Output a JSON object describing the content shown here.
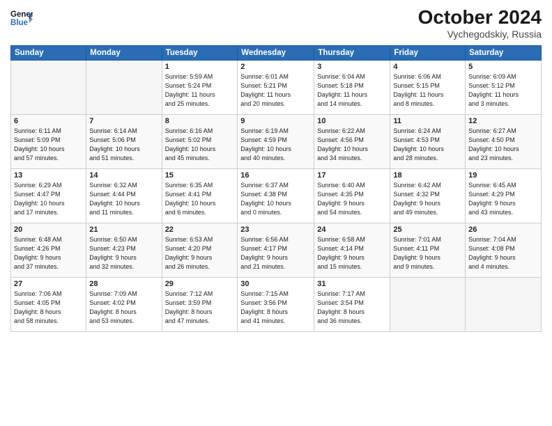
{
  "header": {
    "logo_line1": "General",
    "logo_line2": "Blue",
    "month": "October 2024",
    "location": "Vychegodskiy, Russia"
  },
  "weekdays": [
    "Sunday",
    "Monday",
    "Tuesday",
    "Wednesday",
    "Thursday",
    "Friday",
    "Saturday"
  ],
  "weeks": [
    [
      {
        "day": "",
        "info": ""
      },
      {
        "day": "",
        "info": ""
      },
      {
        "day": "1",
        "info": "Sunrise: 5:59 AM\nSunset: 5:24 PM\nDaylight: 11 hours\nand 25 minutes."
      },
      {
        "day": "2",
        "info": "Sunrise: 6:01 AM\nSunset: 5:21 PM\nDaylight: 11 hours\nand 20 minutes."
      },
      {
        "day": "3",
        "info": "Sunrise: 6:04 AM\nSunset: 5:18 PM\nDaylight: 11 hours\nand 14 minutes."
      },
      {
        "day": "4",
        "info": "Sunrise: 6:06 AM\nSunset: 5:15 PM\nDaylight: 11 hours\nand 8 minutes."
      },
      {
        "day": "5",
        "info": "Sunrise: 6:09 AM\nSunset: 5:12 PM\nDaylight: 11 hours\nand 3 minutes."
      }
    ],
    [
      {
        "day": "6",
        "info": "Sunrise: 6:11 AM\nSunset: 5:09 PM\nDaylight: 10 hours\nand 57 minutes."
      },
      {
        "day": "7",
        "info": "Sunrise: 6:14 AM\nSunset: 5:06 PM\nDaylight: 10 hours\nand 51 minutes."
      },
      {
        "day": "8",
        "info": "Sunrise: 6:16 AM\nSunset: 5:02 PM\nDaylight: 10 hours\nand 45 minutes."
      },
      {
        "day": "9",
        "info": "Sunrise: 6:19 AM\nSunset: 4:59 PM\nDaylight: 10 hours\nand 40 minutes."
      },
      {
        "day": "10",
        "info": "Sunrise: 6:22 AM\nSunset: 4:56 PM\nDaylight: 10 hours\nand 34 minutes."
      },
      {
        "day": "11",
        "info": "Sunrise: 6:24 AM\nSunset: 4:53 PM\nDaylight: 10 hours\nand 28 minutes."
      },
      {
        "day": "12",
        "info": "Sunrise: 6:27 AM\nSunset: 4:50 PM\nDaylight: 10 hours\nand 23 minutes."
      }
    ],
    [
      {
        "day": "13",
        "info": "Sunrise: 6:29 AM\nSunset: 4:47 PM\nDaylight: 10 hours\nand 17 minutes."
      },
      {
        "day": "14",
        "info": "Sunrise: 6:32 AM\nSunset: 4:44 PM\nDaylight: 10 hours\nand 11 minutes."
      },
      {
        "day": "15",
        "info": "Sunrise: 6:35 AM\nSunset: 4:41 PM\nDaylight: 10 hours\nand 6 minutes."
      },
      {
        "day": "16",
        "info": "Sunrise: 6:37 AM\nSunset: 4:38 PM\nDaylight: 10 hours\nand 0 minutes."
      },
      {
        "day": "17",
        "info": "Sunrise: 6:40 AM\nSunset: 4:35 PM\nDaylight: 9 hours\nand 54 minutes."
      },
      {
        "day": "18",
        "info": "Sunrise: 6:42 AM\nSunset: 4:32 PM\nDaylight: 9 hours\nand 49 minutes."
      },
      {
        "day": "19",
        "info": "Sunrise: 6:45 AM\nSunset: 4:29 PM\nDaylight: 9 hours\nand 43 minutes."
      }
    ],
    [
      {
        "day": "20",
        "info": "Sunrise: 6:48 AM\nSunset: 4:26 PM\nDaylight: 9 hours\nand 37 minutes."
      },
      {
        "day": "21",
        "info": "Sunrise: 6:50 AM\nSunset: 4:23 PM\nDaylight: 9 hours\nand 32 minutes."
      },
      {
        "day": "22",
        "info": "Sunrise: 6:53 AM\nSunset: 4:20 PM\nDaylight: 9 hours\nand 26 minutes."
      },
      {
        "day": "23",
        "info": "Sunrise: 6:56 AM\nSunset: 4:17 PM\nDaylight: 9 hours\nand 21 minutes."
      },
      {
        "day": "24",
        "info": "Sunrise: 6:58 AM\nSunset: 4:14 PM\nDaylight: 9 hours\nand 15 minutes."
      },
      {
        "day": "25",
        "info": "Sunrise: 7:01 AM\nSunset: 4:11 PM\nDaylight: 9 hours\nand 9 minutes."
      },
      {
        "day": "26",
        "info": "Sunrise: 7:04 AM\nSunset: 4:08 PM\nDaylight: 9 hours\nand 4 minutes."
      }
    ],
    [
      {
        "day": "27",
        "info": "Sunrise: 7:06 AM\nSunset: 4:05 PM\nDaylight: 8 hours\nand 58 minutes."
      },
      {
        "day": "28",
        "info": "Sunrise: 7:09 AM\nSunset: 4:02 PM\nDaylight: 8 hours\nand 53 minutes."
      },
      {
        "day": "29",
        "info": "Sunrise: 7:12 AM\nSunset: 3:59 PM\nDaylight: 8 hours\nand 47 minutes."
      },
      {
        "day": "30",
        "info": "Sunrise: 7:15 AM\nSunset: 3:56 PM\nDaylight: 8 hours\nand 41 minutes."
      },
      {
        "day": "31",
        "info": "Sunrise: 7:17 AM\nSunset: 3:54 PM\nDaylight: 8 hours\nand 36 minutes."
      },
      {
        "day": "",
        "info": ""
      },
      {
        "day": "",
        "info": ""
      }
    ]
  ]
}
